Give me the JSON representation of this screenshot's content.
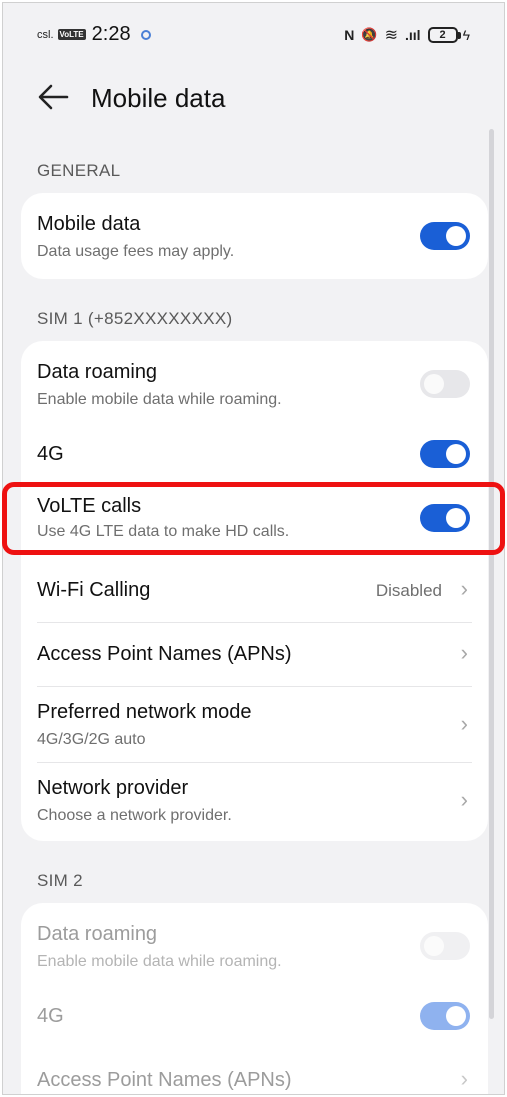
{
  "status_bar": {
    "carrier": "csl.",
    "volte_badge": "VoLTE",
    "time": "2:28",
    "nfc_glyph": "N",
    "mute_glyph": "🔕",
    "wifi_glyph": "≋",
    "signal_glyph": ".ııl",
    "battery_level": "2",
    "charging_glyph": "ϟ"
  },
  "header": {
    "title": "Mobile data",
    "back_icon": "back-arrow-icon"
  },
  "sections": {
    "general": {
      "label": "GENERAL",
      "mobile_data": {
        "title": "Mobile data",
        "subtitle": "Data usage fees may apply.",
        "enabled": true
      }
    },
    "sim1": {
      "label": "SIM 1 (+852XXXXXXXX)",
      "data_roaming": {
        "title": "Data roaming",
        "subtitle": "Enable mobile data while roaming.",
        "enabled": false
      },
      "4g": {
        "title": "4G",
        "enabled": true
      },
      "volte": {
        "title": "VoLTE calls",
        "subtitle": "Use 4G LTE data to make HD calls.",
        "enabled": true
      },
      "wifi_calling": {
        "title": "Wi-Fi Calling",
        "value": "Disabled"
      },
      "apn": {
        "title": "Access Point Names (APNs)"
      },
      "network_mode": {
        "title": "Preferred network mode",
        "subtitle": "4G/3G/2G auto"
      },
      "network_provider": {
        "title": "Network provider",
        "subtitle": "Choose a network provider."
      }
    },
    "sim2": {
      "label": "SIM 2",
      "data_roaming": {
        "title": "Data roaming",
        "subtitle": "Enable mobile data while roaming.",
        "enabled": false
      },
      "4g": {
        "title": "4G",
        "enabled": true
      },
      "apn": {
        "title": "Access Point Names (APNs)"
      }
    }
  },
  "chevron_glyph": "›",
  "colors": {
    "accent": "#1a5fd6",
    "highlight": "#ee1111",
    "background": "#f2f2f4"
  }
}
